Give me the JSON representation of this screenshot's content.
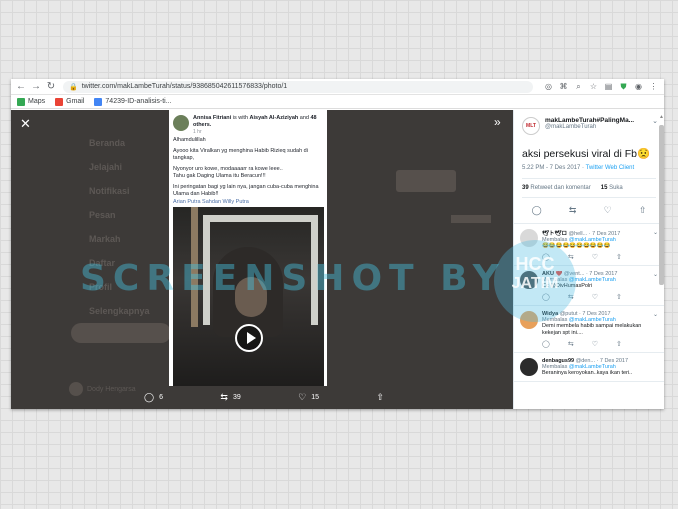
{
  "browser": {
    "url": "twitter.com/makLambeTurah/status/938685042611576833/photo/1",
    "bookmarks": [
      {
        "label": "Maps",
        "icon": "maps-icon",
        "color": "#34a853"
      },
      {
        "label": "Gmail",
        "icon": "gmail-icon",
        "color": "#ea4335"
      },
      {
        "label": "74239-ID-analisis-ti...",
        "icon": "bookmark-page-icon",
        "color": "#4285f4"
      }
    ]
  },
  "background_nav": {
    "items": [
      "Beranda",
      "Jelajahi",
      "Notifikasi",
      "Pesan",
      "Markah",
      "Daftar",
      "Profil",
      "Selengkapnya"
    ],
    "user": "Dody Hengarsa"
  },
  "fb_post": {
    "author": "Annisa Fitriani",
    "with_text": "is with",
    "tagged": "Aisyah Al-Aziziyah",
    "and_text": "and",
    "others": "48 others.",
    "time": "1 hr",
    "p1": "Alhamdulillah",
    "p2": "Ayooo kita Viralkan yg menghina Habib Rizieq sudah di tangkap,",
    "p3": "Nyonyor uro kowe, modaaaarr ra kowe leee..",
    "p4": "Tahu gak Daging Ulama itu Beracun!!!",
    "p5": "Ini peringatan bagi yg lain nya, jangan cuba-cuba menghina Ulama dan Habib!!",
    "tags": "Arian Putra Sahdan Willy Putra"
  },
  "actions": {
    "replies": "6",
    "retweets": "39",
    "likes": "15"
  },
  "tweet": {
    "name": "makLambeTurah#PalingMa...",
    "handle": "@makLambeTurah",
    "avatar_text": "MLT",
    "text": "aksi persekusi viral di Fb😟",
    "time": "5.22 PM - 7 Des 2017",
    "separator": "·",
    "client": "Twitter Web Client",
    "retweet_count": "39",
    "retweet_label": "Retweet dan komentar",
    "like_count": "15",
    "like_label": "Suka"
  },
  "replies": [
    {
      "name": "🕊ト🕊ロ",
      "handle": "@hell...",
      "date": "· 7 Des 2017",
      "reply_label": "Membalas",
      "reply_to": "@makLambeTurah",
      "text": "😂😂😂😂😂😂😂😂😂😂",
      "avatar_color": "#d9d9d9"
    },
    {
      "name": "AKU ❤️",
      "handle": "@vent...",
      "date": "· 7 Des 2017",
      "reply_label": "Membalas",
      "reply_to": "@makLambeTurah",
      "text": "Cc @DivHumasPolri",
      "avatar_color": "#4a4a4a"
    },
    {
      "name": "Widya",
      "handle": "@putut",
      "date": "· 7 Des 2017",
      "reply_label": "Membalas",
      "reply_to": "@makLambeTurah",
      "text": "Demi membela habib sampai melakukan kekejan spt ini....",
      "avatar_color": "#e8a05a"
    },
    {
      "name": "denbagus99",
      "handle": "@den...",
      "date": "· 7 Des 2017",
      "reply_label": "Membalas",
      "reply_to": "@makLambeTurah",
      "text": "Beraninya keroyokan..kaya ikan teri..",
      "avatar_color": "#2b2b2b"
    }
  ],
  "watermark": {
    "text": "SCREENSHOT BY",
    "logo_line1": "HCC",
    "logo_line2": "JATIM"
  }
}
